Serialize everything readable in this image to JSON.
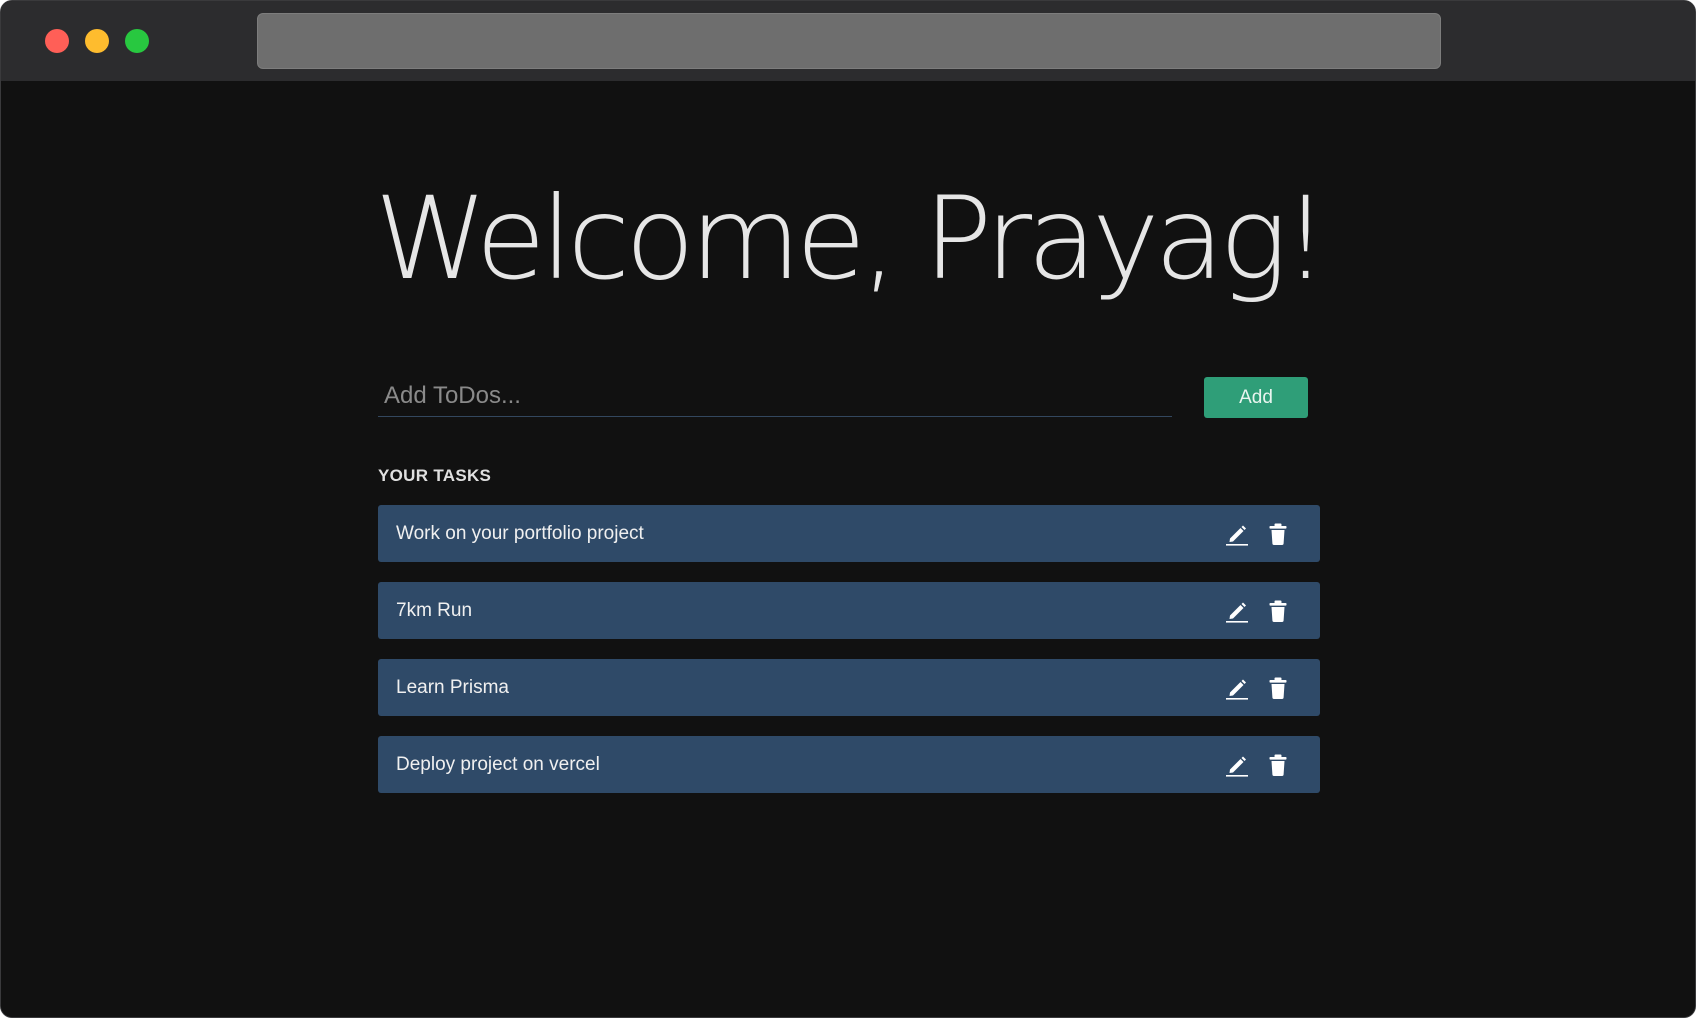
{
  "window": {
    "controls": [
      "close",
      "minimize",
      "maximize"
    ]
  },
  "page": {
    "heading": "Welcome, Prayag!"
  },
  "todo_form": {
    "input_placeholder": "Add ToDos...",
    "input_value": "",
    "add_label": "Add"
  },
  "tasks_section": {
    "label": "YOUR TASKS",
    "items": [
      {
        "text": "Work on your portfolio project",
        "edit_icon": "pencil-icon",
        "delete_icon": "trash-icon"
      },
      {
        "text": "7km Run",
        "edit_icon": "pencil-icon",
        "delete_icon": "trash-icon"
      },
      {
        "text": "Learn Prisma",
        "edit_icon": "pencil-icon",
        "delete_icon": "trash-icon"
      },
      {
        "text": "Deploy project on vercel",
        "edit_icon": "pencil-icon",
        "delete_icon": "trash-icon"
      }
    ]
  },
  "colors": {
    "background": "#111111",
    "titlebar": "#2c2c2e",
    "task_row": "#2f4a68",
    "add_button": "#2f9e78",
    "close": "#ff5f57",
    "minimize": "#febc2e",
    "maximize": "#28c840"
  }
}
